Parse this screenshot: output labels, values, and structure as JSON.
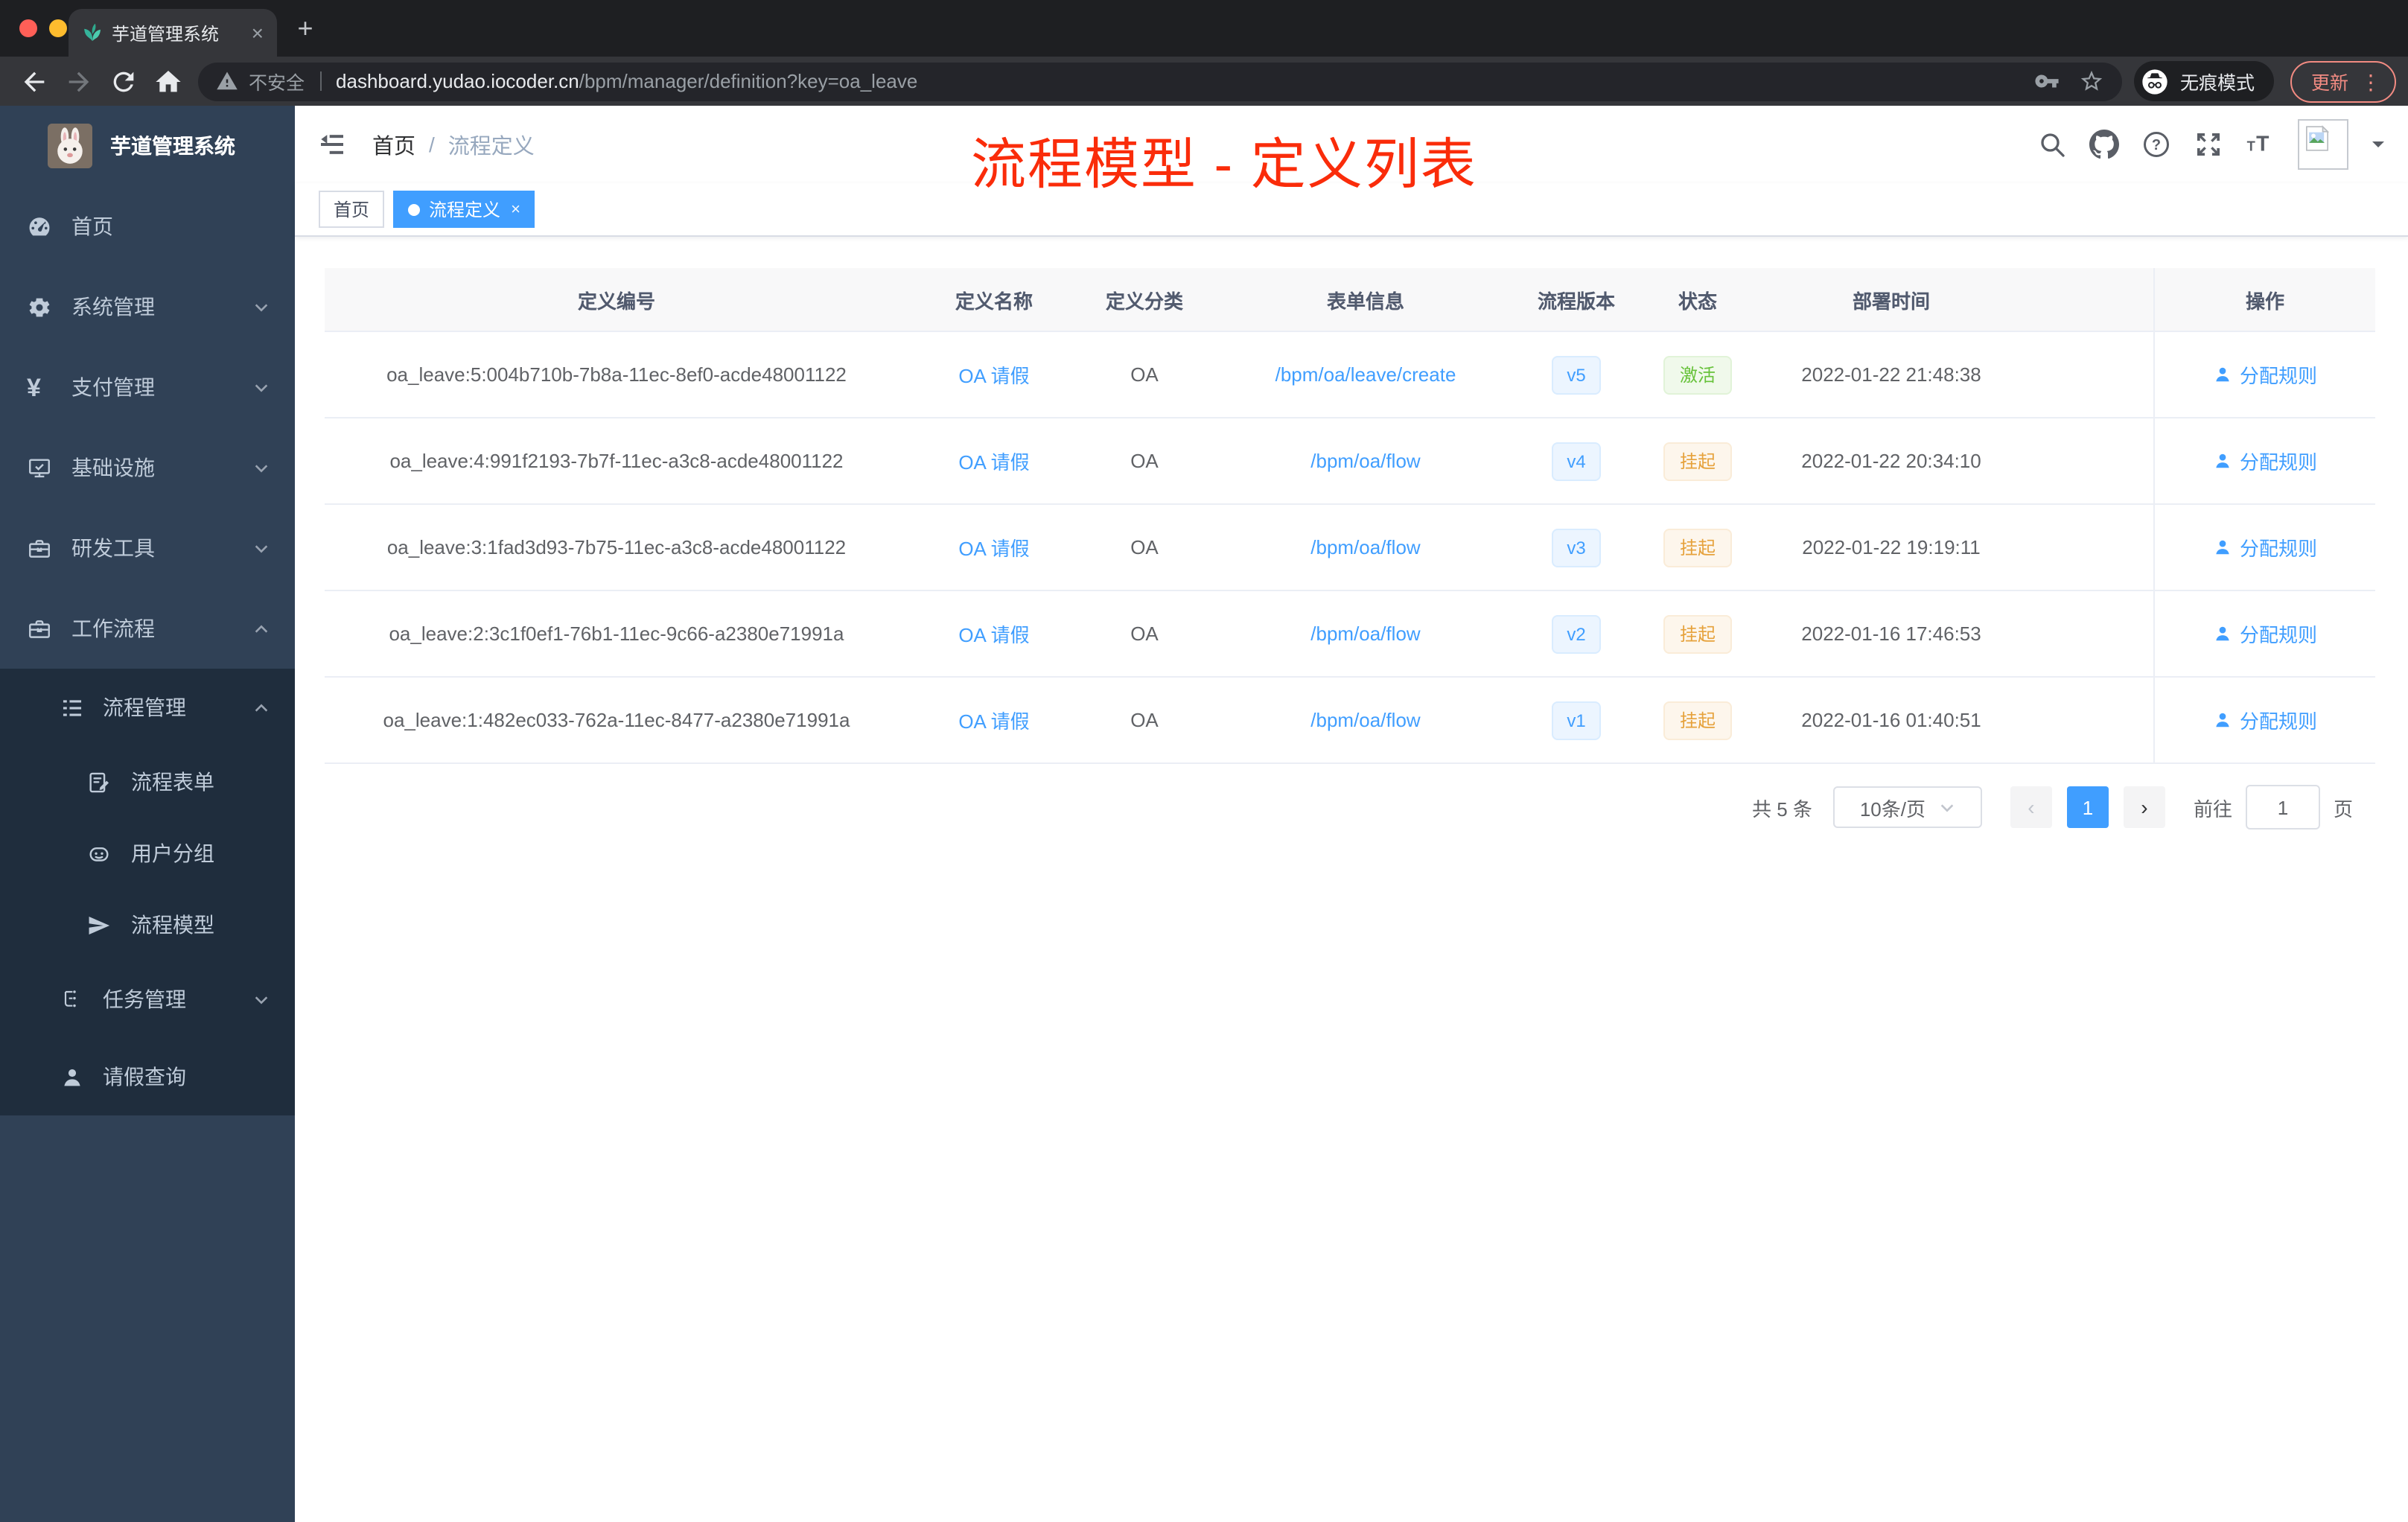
{
  "browser": {
    "tab": {
      "title": "芋道管理系统"
    },
    "address": {
      "security_label": "不安全",
      "host": "dashboard.yudao.iocoder.cn",
      "path": "/bpm/manager/definition?key=oa_leave"
    },
    "incognito_label": "无痕模式",
    "update_label": "更新"
  },
  "glyphs": {
    "close": "×",
    "plus": "+",
    "dots": "⋮",
    "slash": "/",
    "prev": "‹",
    "next": "›"
  },
  "sidebar": {
    "title": "芋道管理系统",
    "menu": [
      {
        "key": "home",
        "label": "首页",
        "icon": "dashboard-icon",
        "depth": 0,
        "dark": false,
        "chevron": null
      },
      {
        "key": "system-mgmt",
        "label": "系统管理",
        "icon": "gear-icon",
        "depth": 0,
        "dark": false,
        "chevron": "down"
      },
      {
        "key": "payment-mgmt",
        "label": "支付管理",
        "icon": "yen-icon",
        "depth": 0,
        "dark": false,
        "chevron": "down"
      },
      {
        "key": "infrastructure",
        "label": "基础设施",
        "icon": "monitor-icon",
        "depth": 0,
        "dark": false,
        "chevron": "down"
      },
      {
        "key": "dev-tools",
        "label": "研发工具",
        "icon": "toolbox-icon",
        "depth": 0,
        "dark": false,
        "chevron": "down"
      },
      {
        "key": "workflow",
        "label": "工作流程",
        "icon": "toolbox-icon",
        "depth": 0,
        "dark": false,
        "chevron": "up"
      },
      {
        "key": "process-mgmt",
        "label": "流程管理",
        "icon": "list-icon",
        "depth": 1,
        "dark": true,
        "chevron": "up"
      },
      {
        "key": "process-form",
        "label": "流程表单",
        "icon": "form-icon",
        "depth": 2,
        "dark": true,
        "chevron": null
      },
      {
        "key": "user-group",
        "label": "用户分组",
        "icon": "robot-icon",
        "depth": 2,
        "dark": true,
        "chevron": null
      },
      {
        "key": "process-model",
        "label": "流程模型",
        "icon": "send-icon",
        "depth": 2,
        "dark": true,
        "chevron": null
      },
      {
        "key": "task-mgmt",
        "label": "任务管理",
        "icon": "tree-icon",
        "depth": 1,
        "dark": true,
        "chevron": "down"
      },
      {
        "key": "leave-query",
        "label": "请假查询",
        "icon": "user-icon",
        "depth": 1,
        "dark": true,
        "chevron": null
      }
    ]
  },
  "topbar": {
    "breadcrumb": [
      "首页",
      "流程定义"
    ]
  },
  "annotation": "流程模型 - 定义列表",
  "tags": [
    {
      "label": "首页",
      "active": false
    },
    {
      "label": "流程定义",
      "active": true
    }
  ],
  "table": {
    "columns": [
      "定义编号",
      "定义名称",
      "定义分类",
      "表单信息",
      "流程版本",
      "状态",
      "部署时间",
      "",
      "操作"
    ],
    "rows": [
      {
        "id": "oa_leave:5:004b710b-7b8a-11ec-8ef0-acde48001122",
        "name": "OA 请假",
        "category": "OA",
        "form": "/bpm/oa/leave/create",
        "version": "v5",
        "status": "激活",
        "status_type": "success",
        "deployed_at": "2022-01-22 21:48:38",
        "action": "分配规则"
      },
      {
        "id": "oa_leave:4:991f2193-7b7f-11ec-a3c8-acde48001122",
        "name": "OA 请假",
        "category": "OA",
        "form": "/bpm/oa/flow",
        "version": "v4",
        "status": "挂起",
        "status_type": "warning",
        "deployed_at": "2022-01-22 20:34:10",
        "action": "分配规则"
      },
      {
        "id": "oa_leave:3:1fad3d93-7b75-11ec-a3c8-acde48001122",
        "name": "OA 请假",
        "category": "OA",
        "form": "/bpm/oa/flow",
        "version": "v3",
        "status": "挂起",
        "status_type": "warning",
        "deployed_at": "2022-01-22 19:19:11",
        "action": "分配规则"
      },
      {
        "id": "oa_leave:2:3c1f0ef1-76b1-11ec-9c66-a2380e71991a",
        "name": "OA 请假",
        "category": "OA",
        "form": "/bpm/oa/flow",
        "version": "v2",
        "status": "挂起",
        "status_type": "warning",
        "deployed_at": "2022-01-16 17:46:53",
        "action": "分配规则"
      },
      {
        "id": "oa_leave:1:482ec033-762a-11ec-8477-a2380e71991a",
        "name": "OA 请假",
        "category": "OA",
        "form": "/bpm/oa/flow",
        "version": "v1",
        "status": "挂起",
        "status_type": "warning",
        "deployed_at": "2022-01-16 01:40:51",
        "action": "分配规则"
      }
    ]
  },
  "pagination": {
    "total": "共 5 条",
    "page_size": "10条/页",
    "current": "1",
    "goto_label": "前往",
    "goto_value": "1",
    "unit_label": "页"
  },
  "colors": {
    "accent": "#409eff",
    "link": "#409eff",
    "success": "#67c23a",
    "warning": "#e6a23c",
    "annotation_red": "#fa2c0a",
    "sidebar_bg": "#304156",
    "sidebar_submenu_bg": "#1f2d3d",
    "sidebar_text": "#bfcbd9",
    "chrome_frame": "#1e1f22",
    "chrome_toolbar": "#35363a",
    "update_salmon": "#f28b82",
    "traffic_red": "#ff5f57",
    "traffic_yellow": "#febc2e",
    "traffic_green": "#28c840"
  }
}
